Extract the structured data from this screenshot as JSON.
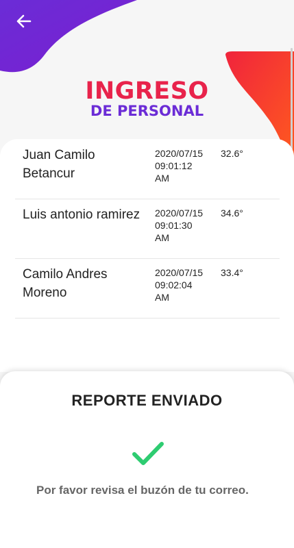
{
  "header": {
    "back_icon": "arrow-left-icon",
    "title_main": "INGRESO",
    "title_sub": "DE PERSONAL"
  },
  "colors": {
    "purple": "#6b2cd6",
    "red": "#e8234b",
    "check_green": "#2ecc71"
  },
  "entries": [
    {
      "name": "Juan Camilo Betancur",
      "date": "2020/07/15",
      "time": "09:01:12",
      "ampm": "AM",
      "temp": "32.6°"
    },
    {
      "name": "Luis antonio ramirez",
      "date": "2020/07/15",
      "time": "09:01:30",
      "ampm": "AM",
      "temp": "34.6°"
    },
    {
      "name": "Camilo Andres Moreno",
      "date": "2020/07/15",
      "time": "09:02:04",
      "ampm": "AM",
      "temp": "33.4°"
    }
  ],
  "sheet": {
    "title": "REPORTE ENVIADO",
    "icon": "checkmark-icon",
    "message": "Por favor revisa el buzón de tu correo."
  }
}
